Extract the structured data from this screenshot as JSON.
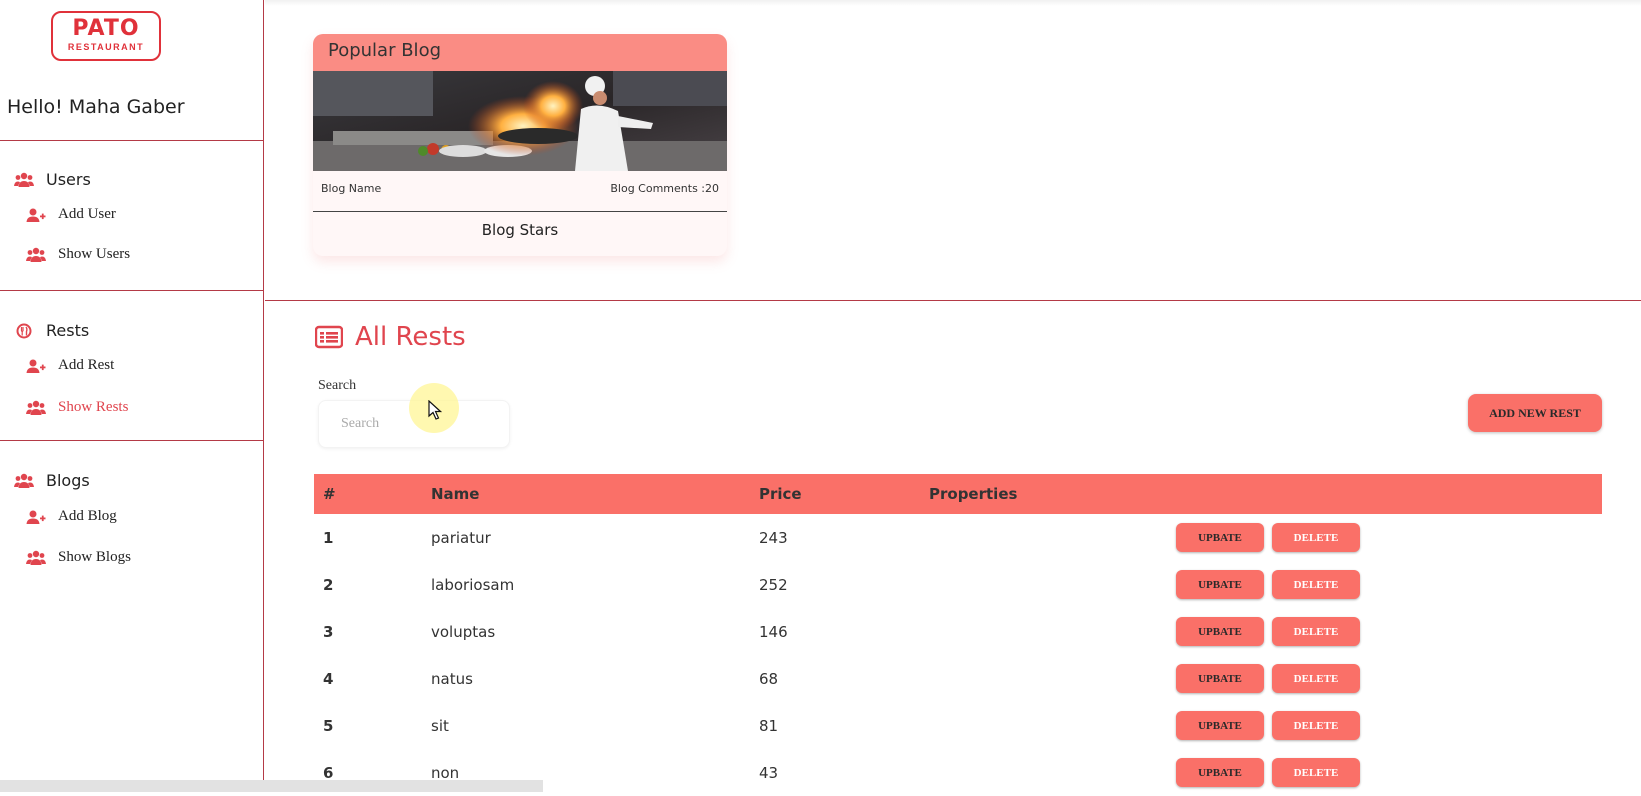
{
  "brand": {
    "logo_main": "PATO",
    "logo_sub": "RESTAURANT"
  },
  "sidebar": {
    "greeting": "Hello! Maha Gaber",
    "sections": [
      {
        "title": "Users",
        "icon": "users-icon",
        "items": [
          {
            "label": "Add User",
            "icon": "user-plus-icon"
          },
          {
            "label": "Show Users",
            "icon": "users-icon"
          }
        ]
      },
      {
        "title": "Rests",
        "icon": "restaurant-icon",
        "items": [
          {
            "label": "Add Rest",
            "icon": "user-plus-icon"
          },
          {
            "label": "Show Rests",
            "icon": "users-icon",
            "active": true
          }
        ]
      },
      {
        "title": "Blogs",
        "icon": "users-icon",
        "items": [
          {
            "label": "Add Blog",
            "icon": "user-plus-icon"
          },
          {
            "label": "Show Blogs",
            "icon": "users-icon"
          }
        ]
      }
    ]
  },
  "blog_card": {
    "header": "Popular Blog",
    "name": "Blog Name",
    "comments": "Blog Comments :20",
    "stars": "Blog Stars"
  },
  "rests": {
    "title": "All Rests",
    "search_label": "Search",
    "search_placeholder": "Search",
    "add_button": "ADD NEW REST",
    "columns": [
      "#",
      "Name",
      "Price",
      "Properties"
    ],
    "update_label": "UPBATE",
    "delete_label": "DELETE",
    "rows": [
      {
        "id": "1",
        "name": "pariatur",
        "price": "243"
      },
      {
        "id": "2",
        "name": "laboriosam",
        "price": "252"
      },
      {
        "id": "3",
        "name": "voluptas",
        "price": "146"
      },
      {
        "id": "4",
        "name": "natus",
        "price": "68"
      },
      {
        "id": "5",
        "name": "sit",
        "price": "81"
      },
      {
        "id": "6",
        "name": "non",
        "price": "43"
      }
    ]
  },
  "colors": {
    "accent": "#fa7068",
    "brand_red": "#e0313a",
    "divider": "#b43a46"
  }
}
